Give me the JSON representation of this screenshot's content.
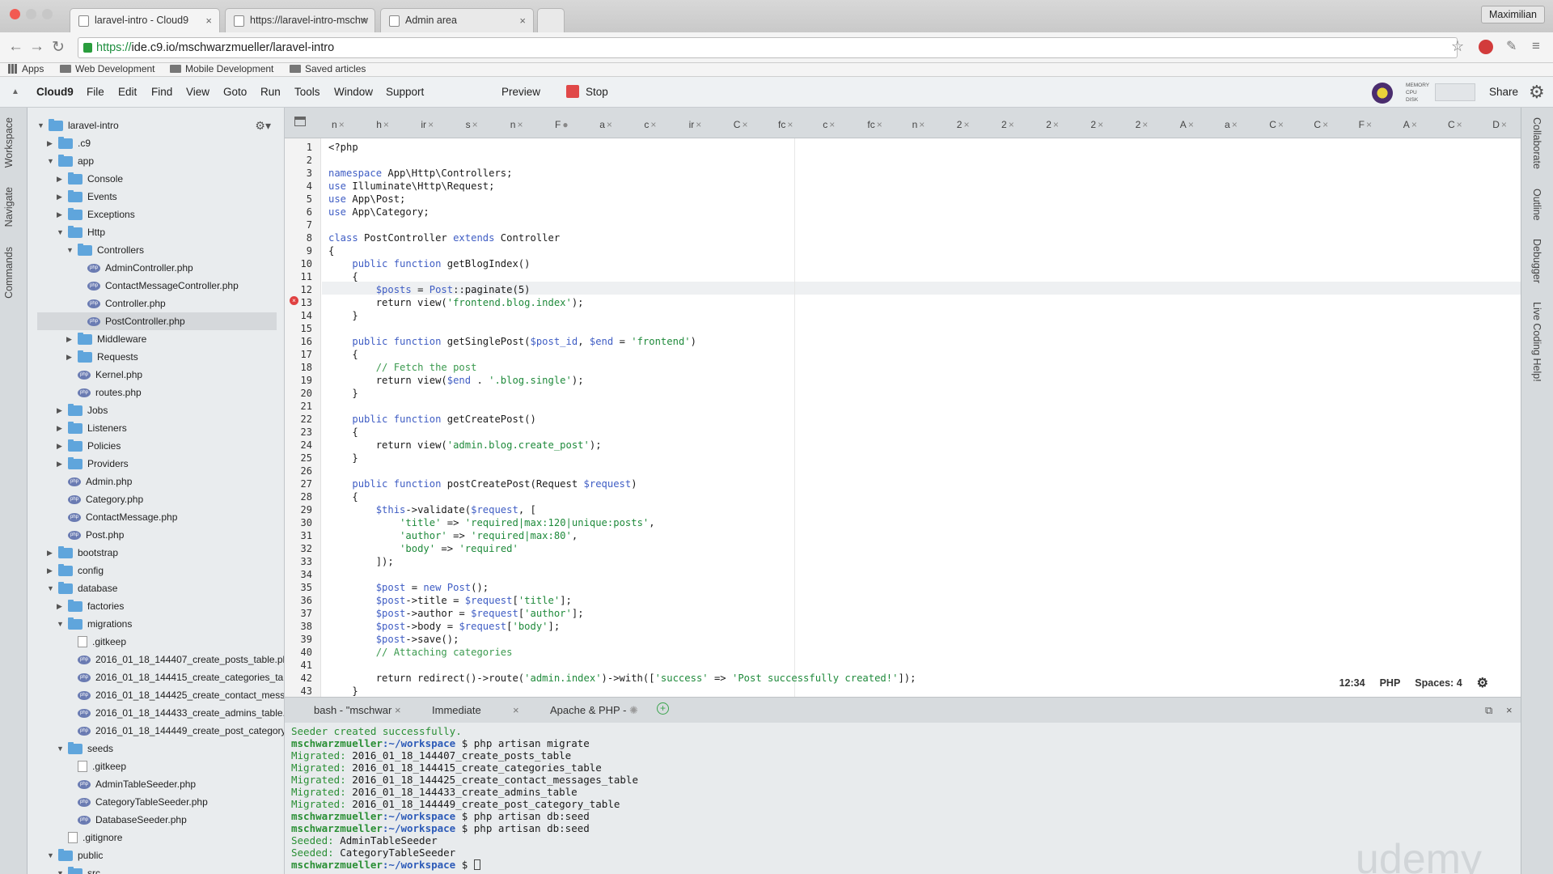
{
  "browser": {
    "tabs": [
      {
        "label": "laravel-intro - Cloud9"
      },
      {
        "label": "https://laravel-intro-mschw"
      },
      {
        "label": "Admin area"
      }
    ],
    "profile": "Maximilian",
    "url_scheme": "https://",
    "url_rest": "ide.c9.io/mschwarzmueller/laravel-intro",
    "bookmarks": [
      "Apps",
      "Web Development",
      "Mobile Development",
      "Saved articles"
    ]
  },
  "ide": {
    "brand": "Cloud9",
    "menu": [
      "File",
      "Edit",
      "Find",
      "View",
      "Goto",
      "Run",
      "Tools",
      "Window",
      "Support"
    ],
    "preview": "Preview",
    "stop": "Stop",
    "share": "Share",
    "meters": [
      "MEMORY",
      "CPU",
      "DISK"
    ],
    "left_panels": [
      "Workspace",
      "Navigate",
      "Commands"
    ],
    "right_panels": [
      "Collaborate",
      "Outline",
      "Debugger",
      "Live Coding Help!"
    ],
    "editor_tabs": [
      "n",
      "h",
      "ir",
      "s",
      "n",
      "F",
      "a",
      "c",
      "ir",
      "C",
      "fc",
      "c",
      "fc",
      "n",
      "2",
      "2",
      "2",
      "2",
      "2",
      "A",
      "a",
      "C",
      "C",
      "F",
      "A",
      "C",
      "D"
    ],
    "status": {
      "position": "12:34",
      "language": "PHP",
      "spaces": "Spaces: 4"
    }
  },
  "tree": [
    {
      "label": "laravel-intro",
      "type": "folder",
      "depth": 0,
      "open": true
    },
    {
      "label": ".c9",
      "type": "folder",
      "depth": 1,
      "open": false
    },
    {
      "label": "app",
      "type": "folder",
      "depth": 1,
      "open": true
    },
    {
      "label": "Console",
      "type": "folder",
      "depth": 2,
      "open": false
    },
    {
      "label": "Events",
      "type": "folder",
      "depth": 2,
      "open": false
    },
    {
      "label": "Exceptions",
      "type": "folder",
      "depth": 2,
      "open": false
    },
    {
      "label": "Http",
      "type": "folder",
      "depth": 2,
      "open": true
    },
    {
      "label": "Controllers",
      "type": "folder",
      "depth": 3,
      "open": true
    },
    {
      "label": "AdminController.php",
      "type": "php",
      "depth": 4
    },
    {
      "label": "ContactMessageController.php",
      "type": "php",
      "depth": 4
    },
    {
      "label": "Controller.php",
      "type": "php",
      "depth": 4
    },
    {
      "label": "PostController.php",
      "type": "php",
      "depth": 4,
      "selected": true
    },
    {
      "label": "Middleware",
      "type": "folder",
      "depth": 3,
      "open": false
    },
    {
      "label": "Requests",
      "type": "folder",
      "depth": 3,
      "open": false
    },
    {
      "label": "Kernel.php",
      "type": "php",
      "depth": 3
    },
    {
      "label": "routes.php",
      "type": "php",
      "depth": 3
    },
    {
      "label": "Jobs",
      "type": "folder",
      "depth": 2,
      "open": false
    },
    {
      "label": "Listeners",
      "type": "folder",
      "depth": 2,
      "open": false
    },
    {
      "label": "Policies",
      "type": "folder",
      "depth": 2,
      "open": false
    },
    {
      "label": "Providers",
      "type": "folder",
      "depth": 2,
      "open": false
    },
    {
      "label": "Admin.php",
      "type": "php",
      "depth": 2
    },
    {
      "label": "Category.php",
      "type": "php",
      "depth": 2
    },
    {
      "label": "ContactMessage.php",
      "type": "php",
      "depth": 2
    },
    {
      "label": "Post.php",
      "type": "php",
      "depth": 2
    },
    {
      "label": "bootstrap",
      "type": "folder",
      "depth": 1,
      "open": false
    },
    {
      "label": "config",
      "type": "folder",
      "depth": 1,
      "open": false
    },
    {
      "label": "database",
      "type": "folder",
      "depth": 1,
      "open": true
    },
    {
      "label": "factories",
      "type": "folder",
      "depth": 2,
      "open": false
    },
    {
      "label": "migrations",
      "type": "folder",
      "depth": 2,
      "open": true
    },
    {
      "label": ".gitkeep",
      "type": "file",
      "depth": 3
    },
    {
      "label": "2016_01_18_144407_create_posts_table.ph",
      "type": "php",
      "depth": 3
    },
    {
      "label": "2016_01_18_144415_create_categories_tab",
      "type": "php",
      "depth": 3
    },
    {
      "label": "2016_01_18_144425_create_contact_messa",
      "type": "php",
      "depth": 3
    },
    {
      "label": "2016_01_18_144433_create_admins_table.",
      "type": "php",
      "depth": 3
    },
    {
      "label": "2016_01_18_144449_create_post_category_",
      "type": "php",
      "depth": 3
    },
    {
      "label": "seeds",
      "type": "folder",
      "depth": 2,
      "open": true
    },
    {
      "label": ".gitkeep",
      "type": "file",
      "depth": 3
    },
    {
      "label": "AdminTableSeeder.php",
      "type": "php",
      "depth": 3
    },
    {
      "label": "CategoryTableSeeder.php",
      "type": "php",
      "depth": 3
    },
    {
      "label": "DatabaseSeeder.php",
      "type": "php",
      "depth": 3
    },
    {
      "label": ".gitignore",
      "type": "file",
      "depth": 2
    },
    {
      "label": "public",
      "type": "folder",
      "depth": 1,
      "open": true
    },
    {
      "label": "src",
      "type": "folder",
      "depth": 2,
      "open": true
    }
  ],
  "code_lines": [
    [
      [
        "<?php",
        ""
      ]
    ],
    [],
    [
      [
        "namespace",
        "k"
      ],
      [
        " App\\Http\\Controllers;",
        ""
      ]
    ],
    [
      [
        "use",
        "k"
      ],
      [
        " Illuminate\\Http\\Request;",
        ""
      ]
    ],
    [
      [
        "use",
        "k"
      ],
      [
        " App\\Post;",
        ""
      ]
    ],
    [
      [
        "use",
        "k"
      ],
      [
        " App\\Category;",
        ""
      ]
    ],
    [],
    [
      [
        "class",
        "k"
      ],
      [
        " PostController ",
        ""
      ],
      [
        "extends",
        "k"
      ],
      [
        " Controller",
        ""
      ]
    ],
    [
      [
        "{",
        ""
      ]
    ],
    [
      [
        "    ",
        ""
      ],
      [
        "public function",
        "k"
      ],
      [
        " getBlogIndex()",
        ""
      ]
    ],
    [
      [
        "    {",
        ""
      ]
    ],
    [
      [
        "        ",
        ""
      ],
      [
        "$posts",
        "v"
      ],
      [
        " = ",
        ""
      ],
      [
        "Post",
        "t"
      ],
      [
        "::paginate(5)",
        ""
      ]
    ],
    [
      [
        "        return view(",
        ""
      ],
      [
        "'frontend.blog.index'",
        "s"
      ],
      [
        ");",
        ""
      ]
    ],
    [
      [
        "    }",
        ""
      ]
    ],
    [],
    [
      [
        "    ",
        ""
      ],
      [
        "public function",
        "k"
      ],
      [
        " getSinglePost(",
        ""
      ],
      [
        "$post_id",
        "v"
      ],
      [
        ", ",
        ""
      ],
      [
        "$end",
        "v"
      ],
      [
        " = ",
        ""
      ],
      [
        "'frontend'",
        "s"
      ],
      [
        ")",
        ""
      ]
    ],
    [
      [
        "    {",
        ""
      ]
    ],
    [
      [
        "        ",
        ""
      ],
      [
        "// Fetch the post",
        "c"
      ]
    ],
    [
      [
        "        return view(",
        ""
      ],
      [
        "$end",
        "v"
      ],
      [
        " . ",
        ""
      ],
      [
        "'.blog.single'",
        "s"
      ],
      [
        ");",
        ""
      ]
    ],
    [
      [
        "    }",
        ""
      ]
    ],
    [],
    [
      [
        "    ",
        ""
      ],
      [
        "public function",
        "k"
      ],
      [
        " getCreatePost()",
        ""
      ]
    ],
    [
      [
        "    {",
        ""
      ]
    ],
    [
      [
        "        return view(",
        ""
      ],
      [
        "'admin.blog.create_post'",
        "s"
      ],
      [
        ");",
        ""
      ]
    ],
    [
      [
        "    }",
        ""
      ]
    ],
    [],
    [
      [
        "    ",
        ""
      ],
      [
        "public function",
        "k"
      ],
      [
        " postCreatePost(Request ",
        ""
      ],
      [
        "$request",
        "v"
      ],
      [
        ")",
        ""
      ]
    ],
    [
      [
        "    {",
        ""
      ]
    ],
    [
      [
        "        ",
        ""
      ],
      [
        "$this",
        "v"
      ],
      [
        "->validate(",
        ""
      ],
      [
        "$request",
        "v"
      ],
      [
        ", [",
        ""
      ]
    ],
    [
      [
        "            ",
        ""
      ],
      [
        "'title'",
        "s"
      ],
      [
        " => ",
        ""
      ],
      [
        "'required|max:120|unique:posts'",
        "s"
      ],
      [
        ",",
        ""
      ]
    ],
    [
      [
        "            ",
        ""
      ],
      [
        "'author'",
        "s"
      ],
      [
        " => ",
        ""
      ],
      [
        "'required|max:80'",
        "s"
      ],
      [
        ",",
        ""
      ]
    ],
    [
      [
        "            ",
        ""
      ],
      [
        "'body'",
        "s"
      ],
      [
        " => ",
        ""
      ],
      [
        "'required'",
        "s"
      ]
    ],
    [
      [
        "        ]);",
        ""
      ]
    ],
    [],
    [
      [
        "        ",
        ""
      ],
      [
        "$post",
        "v"
      ],
      [
        " = ",
        ""
      ],
      [
        "new",
        "k"
      ],
      [
        " ",
        ""
      ],
      [
        "Post",
        "t"
      ],
      [
        "();",
        ""
      ]
    ],
    [
      [
        "        ",
        ""
      ],
      [
        "$post",
        "v"
      ],
      [
        "->title = ",
        ""
      ],
      [
        "$request",
        "v"
      ],
      [
        "[",
        ""
      ],
      [
        "'title'",
        "s"
      ],
      [
        "];",
        ""
      ]
    ],
    [
      [
        "        ",
        ""
      ],
      [
        "$post",
        "v"
      ],
      [
        "->author = ",
        ""
      ],
      [
        "$request",
        "v"
      ],
      [
        "[",
        ""
      ],
      [
        "'author'",
        "s"
      ],
      [
        "];",
        ""
      ]
    ],
    [
      [
        "        ",
        ""
      ],
      [
        "$post",
        "v"
      ],
      [
        "->body = ",
        ""
      ],
      [
        "$request",
        "v"
      ],
      [
        "[",
        ""
      ],
      [
        "'body'",
        "s"
      ],
      [
        "];",
        ""
      ]
    ],
    [
      [
        "        ",
        ""
      ],
      [
        "$post",
        "v"
      ],
      [
        "->save();",
        ""
      ]
    ],
    [
      [
        "        ",
        ""
      ],
      [
        "// Attaching categories",
        "c"
      ]
    ],
    [],
    [
      [
        "        return redirect()->route(",
        ""
      ],
      [
        "'admin.index'",
        "s"
      ],
      [
        ")->with([",
        ""
      ],
      [
        "'success'",
        "s"
      ],
      [
        " => ",
        ""
      ],
      [
        "'Post successfully created!'",
        "s"
      ],
      [
        "]);",
        ""
      ]
    ],
    [
      [
        "    }",
        ""
      ]
    ]
  ],
  "terminal": {
    "tabs": [
      "bash - \"mschwar",
      "Immediate",
      "Apache & PHP -"
    ],
    "lines": [
      [
        [
          "Seeder created successfully.",
          "tg"
        ]
      ],
      [
        [
          "mschwarzmueller",
          "tb"
        ],
        [
          ":~/workspace",
          "tp"
        ],
        [
          " $ php artisan migrate",
          ""
        ]
      ],
      [
        [
          "Migrated:",
          "tg"
        ],
        [
          " 2016_01_18_144407_create_posts_table",
          ""
        ]
      ],
      [
        [
          "Migrated:",
          "tg"
        ],
        [
          " 2016_01_18_144415_create_categories_table",
          ""
        ]
      ],
      [
        [
          "Migrated:",
          "tg"
        ],
        [
          " 2016_01_18_144425_create_contact_messages_table",
          ""
        ]
      ],
      [
        [
          "Migrated:",
          "tg"
        ],
        [
          " 2016_01_18_144433_create_admins_table",
          ""
        ]
      ],
      [
        [
          "Migrated:",
          "tg"
        ],
        [
          " 2016_01_18_144449_create_post_category_table",
          ""
        ]
      ],
      [
        [
          "mschwarzmueller",
          "tb"
        ],
        [
          ":~/workspace",
          "tp"
        ],
        [
          " $ php artisan db:seed",
          ""
        ]
      ],
      [
        [
          "mschwarzmueller",
          "tb"
        ],
        [
          ":~/workspace",
          "tp"
        ],
        [
          " $ php artisan db:seed",
          ""
        ]
      ],
      [
        [
          "Seeded:",
          "tg"
        ],
        [
          " AdminTableSeeder",
          ""
        ]
      ],
      [
        [
          "Seeded:",
          "tg"
        ],
        [
          " CategoryTableSeeder",
          ""
        ]
      ],
      [
        [
          "mschwarzmueller",
          "tb"
        ],
        [
          ":~/workspace",
          "tp"
        ],
        [
          " $ ",
          ""
        ]
      ]
    ]
  },
  "watermark": "udemy"
}
